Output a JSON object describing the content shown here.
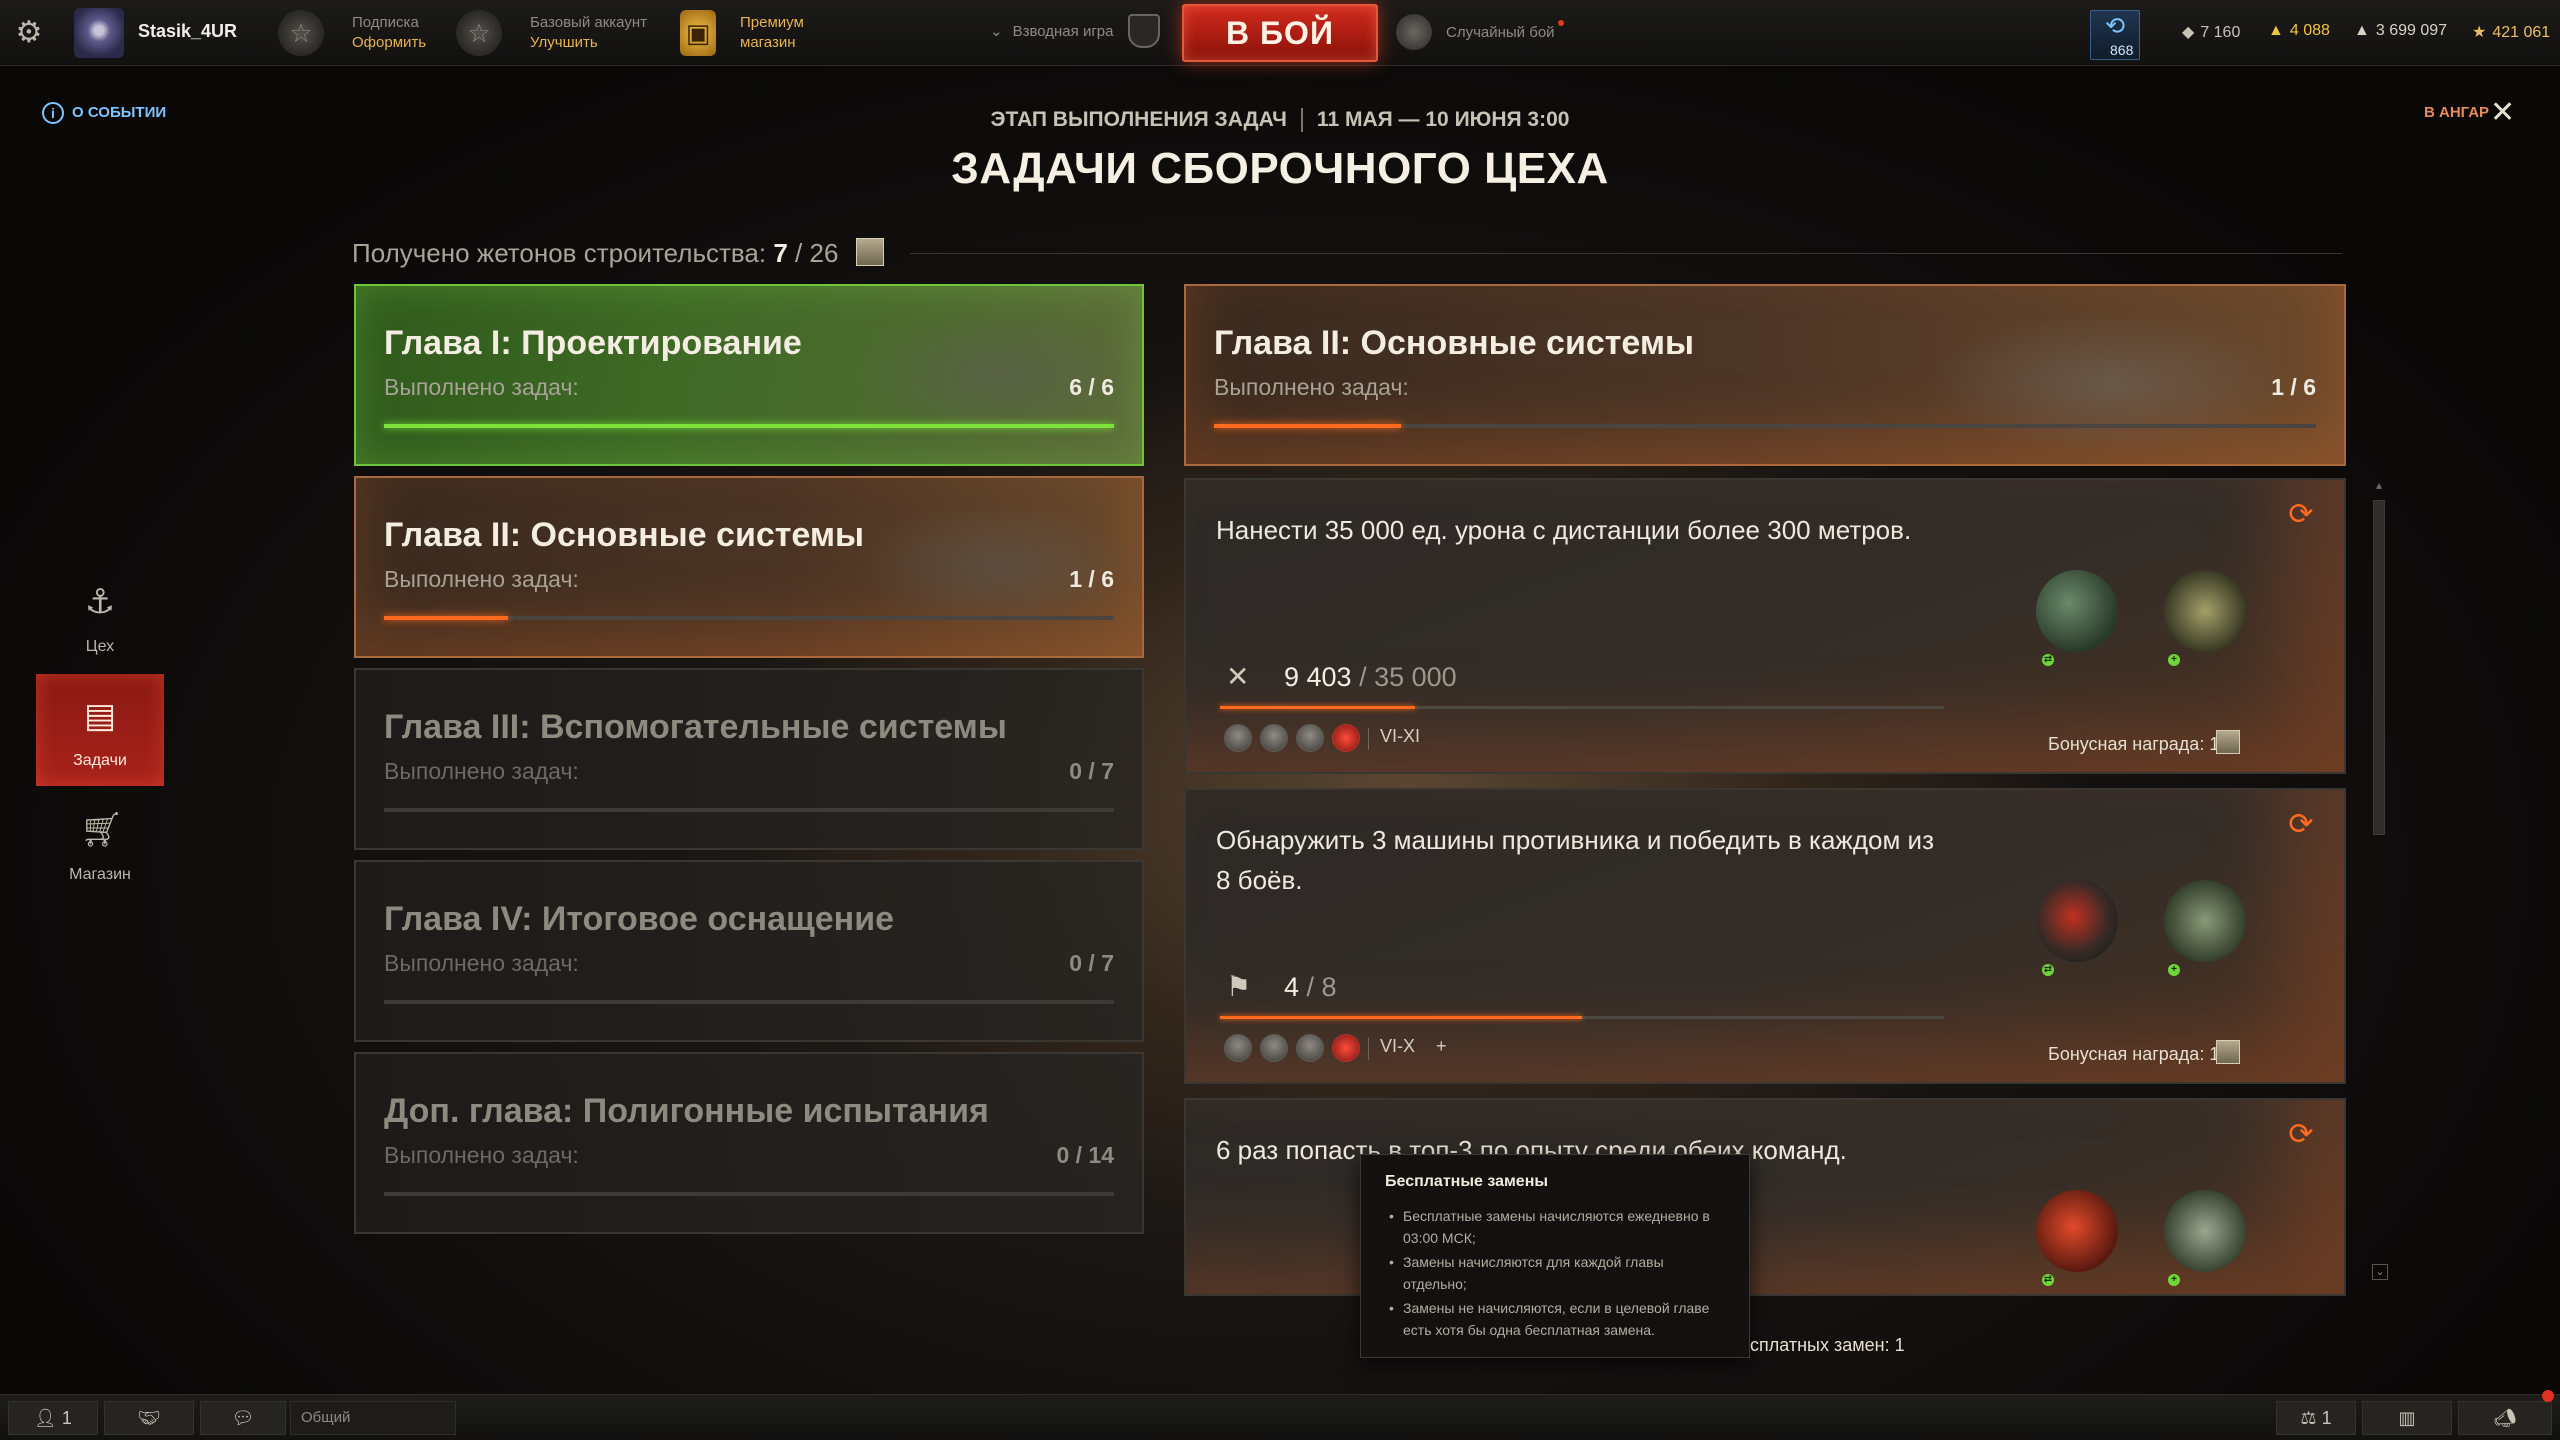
{
  "topbar": {
    "username": "Stasik_4UR",
    "subscription": {
      "line1": "Подписка",
      "line2": "Оформить"
    },
    "account": {
      "line1": "Базовый аккаунт",
      "line2": "Улучшить"
    },
    "premium_shop": {
      "line1": "Премиум",
      "line2": "магазин"
    },
    "platoon_label": "Взводная игра",
    "battle_button": "В БОЙ",
    "battle_mode": "Случайный бой",
    "notifications_count": "868",
    "currencies": {
      "bonds": "7 160",
      "gold": "4 088",
      "credits": "3 699 097",
      "free_xp": "421 061"
    }
  },
  "event": {
    "about_link": "О СОБЫТИИ",
    "to_hangar": "В АНГАР",
    "stage_label": "ЭТАП ВЫПОЛНЕНИЯ ЗАДАЧ",
    "dates": "11 МАЯ — 10 ИЮНЯ 3:00",
    "title": "ЗАДАЧИ СБОРОЧНОГО ЦЕХА",
    "tokens_label": "Получено жетонов строительства:",
    "tokens_got": "7",
    "tokens_total": "/ 26"
  },
  "sidebar": {
    "items": [
      {
        "label": "Цех",
        "icon": "hook-icon"
      },
      {
        "label": "Задачи",
        "icon": "tasks-icon"
      },
      {
        "label": "Магазин",
        "icon": "cart-icon"
      }
    ]
  },
  "chapters": [
    {
      "title": "Глава I: Проектирование",
      "sub": "Выполнено задач:",
      "count": "6 / 6",
      "progress": 1.0,
      "state": "done"
    },
    {
      "title": "Глава II: Основные системы",
      "sub": "Выполнено задач:",
      "count": "1 / 6",
      "progress": 0.17,
      "state": "active"
    },
    {
      "title": "Глава III: Вспомогательные системы",
      "sub": "Выполнено задач:",
      "count": "0 / 7",
      "progress": 0,
      "state": "locked"
    },
    {
      "title": "Глава IV: Итоговое оснащение",
      "sub": "Выполнено задач:",
      "count": "0 / 7",
      "progress": 0,
      "state": "locked"
    },
    {
      "title": "Доп. глава: Полигонные испытания",
      "sub": "Выполнено задач:",
      "count": "0 / 14",
      "progress": 0,
      "state": "locked"
    }
  ],
  "selected_chapter": {
    "title": "Глава II: Основные системы",
    "sub": "Выполнено задач:",
    "count": "1 / 6",
    "progress": 0.17
  },
  "tasks": [
    {
      "description": "Нанести 35 000 ед. урона с дистанции более 300 метров.",
      "progress_current": "9 403",
      "progress_total": "/ 35 000",
      "progress": 0.27,
      "progress_icon": "crossed-swords-icon",
      "tiers": "VI-XI",
      "reward_label": "Бонусная награда: 1"
    },
    {
      "description": "Обнаружить 3 машины противника и победить в каждом из 8 боёв.",
      "progress_current": "4",
      "progress_total": "/ 8",
      "progress": 0.5,
      "progress_icon": "flag-icon",
      "tiers": "VI-X",
      "tier_extra": "+",
      "reward_label": "Бонусная награда: 1"
    },
    {
      "description": "6 раз попасть в топ-3 по опыту среди обеих команд."
    }
  ],
  "tooltip": {
    "title": "Бесплатные замены",
    "items": [
      "Бесплатные замены начисляются ежедневно в 03:00 МСК;",
      "Замены начисляются для каждой главы отдельно;",
      "Замены не начисляются, если в целевой главе есть хотя бы одна бесплатная замена."
    ]
  },
  "free_swaps_label": "сплатных замен: 1",
  "bottombar": {
    "players_online": "1",
    "chat_channel": "Общий",
    "platoon_count": "1"
  },
  "colors": {
    "accent_orange": "#ff6a1e",
    "done_green": "#7de33a",
    "battle_red": "#c41f14",
    "info_blue": "#7fc3ff"
  }
}
